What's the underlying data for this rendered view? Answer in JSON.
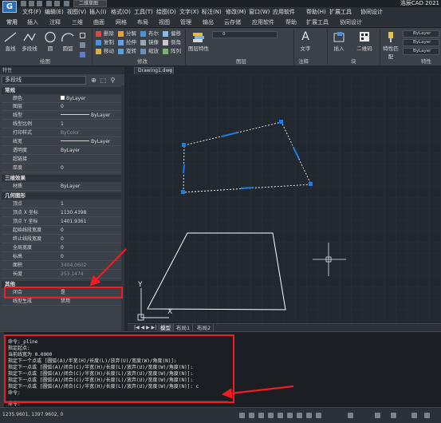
{
  "app": {
    "title": "浩辰CAD 2021",
    "logo_letter": "G",
    "workspace": "二维草图",
    "document_tab": "Drawing1.dwg",
    "document_close": "×"
  },
  "menu": [
    "文件(F)",
    "编辑(E)",
    "视图(V)",
    "插入(I)",
    "格式(O)",
    "工具(T)",
    "绘图(D)",
    "文字(X)",
    "标注(N)",
    "修改(M)",
    "窗口(W)",
    "应用软件",
    "帮助(H)",
    "扩展工具",
    "协同设计"
  ],
  "ribbon_tabs": [
    "常用",
    "插入",
    "注释",
    "三维",
    "曲面",
    "网格",
    "布局",
    "视图",
    "管理",
    "输出",
    "云存储",
    "应用软件",
    "帮助",
    "扩展工具",
    "协同设计"
  ],
  "ribbon": {
    "draw": {
      "title": "绘图",
      "line": "直线",
      "polyline": "多段线",
      "circle": "圆",
      "arc": "圆弧"
    },
    "modify": {
      "title": "修改",
      "buttons": [
        "删除",
        "分解",
        "布尔",
        "偏移",
        "复制",
        "拉伸",
        "镜像",
        "倒角",
        "移动",
        "旋转",
        "缩放",
        "阵列"
      ]
    },
    "layers": {
      "title": "图层",
      "layer_props": "图层特性",
      "current_layer": "0"
    },
    "text": {
      "title": "注释",
      "label": "文字"
    },
    "block": {
      "title": "块",
      "insert": "插入",
      "qrcode": "二维码"
    },
    "properties": {
      "title": "特性",
      "match": "特性匹配",
      "rows": [
        "ByLayer",
        "ByLayer",
        "ByLayer"
      ]
    }
  },
  "properties_palette": {
    "title": "特性",
    "object_type": "多段线",
    "sections": {
      "general": {
        "label": "常规",
        "rows": [
          {
            "key": "颜色",
            "value": "ByLayer"
          },
          {
            "key": "图层",
            "value": "0"
          },
          {
            "key": "线型",
            "value": "ByLayer"
          },
          {
            "key": "线型比例",
            "value": "1"
          },
          {
            "key": "打印样式",
            "value": "ByColor"
          },
          {
            "key": "线宽",
            "value": "ByLayer"
          },
          {
            "key": "透明度",
            "value": "ByLayer"
          },
          {
            "key": "超链接",
            "value": ""
          },
          {
            "key": "厚度",
            "value": "0"
          }
        ]
      },
      "3d": {
        "label": "三维效果",
        "rows": [
          {
            "key": "材质",
            "value": "ByLayer"
          }
        ]
      },
      "geometry": {
        "label": "几何图形",
        "rows": [
          {
            "key": "顶点",
            "value": "1"
          },
          {
            "key": "顶点 X 坐标",
            "value": "1130.4398"
          },
          {
            "key": "顶点 Y 坐标",
            "value": "1401.9361"
          },
          {
            "key": "起始线段宽度",
            "value": "0"
          },
          {
            "key": "终止线段宽度",
            "value": "0"
          },
          {
            "key": "全局宽度",
            "value": "0"
          },
          {
            "key": "标高",
            "value": "0"
          },
          {
            "key": "面积",
            "value": "3404.0602"
          },
          {
            "key": "长度",
            "value": "253.1474"
          }
        ]
      },
      "misc": {
        "label": "其他",
        "rows": [
          {
            "key": "闭合",
            "value": "是"
          },
          {
            "key": "线型生成",
            "value": "禁用"
          }
        ]
      }
    }
  },
  "layout_tabs": [
    "模型",
    "布局1",
    "布局2"
  ],
  "layout_nav": "|◀ ◀ ▶ ▶|",
  "command_history": [
    "命令:_pline",
    "指定起点:",
    "当前线宽为 0.0000",
    "指定下一个点或 [圆弧(A)/半宽(H)/长度(L)/放弃(U)/宽度(W)/角度(N)]:",
    "指定下一点或 [圆弧(A)/闭合(C)/半宽(H)/长度(L)/放弃(U)/宽度(W)/角度(N)]:",
    "指定下一点或 [圆弧(A)/闭合(C)/半宽(H)/长度(L)/放弃(U)/宽度(W)/角度(N)]:",
    "指定下一点或 [圆弧(A)/闭合(C)/半宽(H)/长度(L)/放弃(U)/宽度(W)/角度(N)]:",
    "指定下一点或 [圆弧(A)/闭合(C)/半宽(H)/长度(L)/放弃(U)/宽度(W)/角度(N)]: c",
    "命令:"
  ],
  "command_prompt": "命令:",
  "status": {
    "coordinates": "1235.9601, 1397.9602, 0"
  },
  "ucs": {
    "x_label": "X",
    "y_label": "Y"
  },
  "colors": {
    "canvas": "#212830",
    "highlight": "#ee1c23",
    "grip": "#1e7be0",
    "shape": "#ffffff"
  }
}
